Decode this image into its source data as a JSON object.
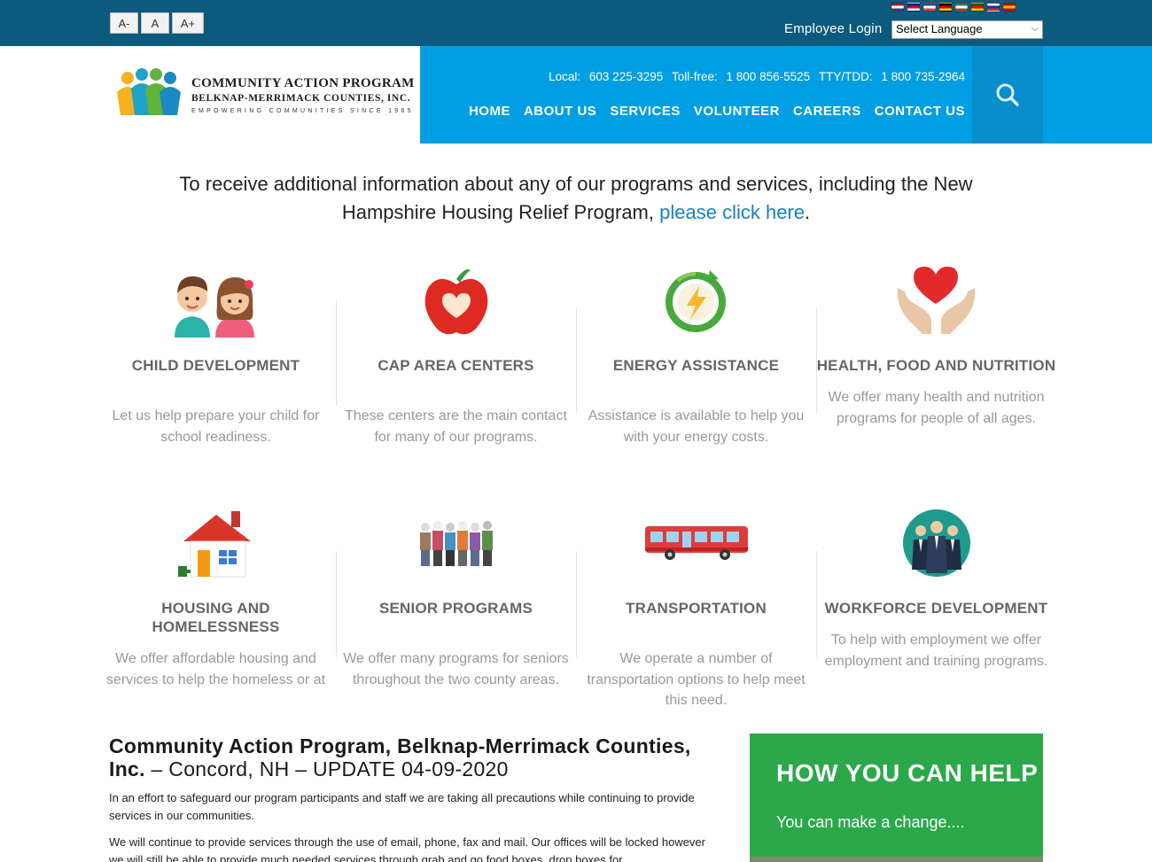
{
  "topbar": {
    "font_sizes": [
      "A-",
      "A",
      "A+"
    ],
    "employee_login": "Employee Login",
    "language_select": "Select Language",
    "flags": [
      {
        "name": "dutch-flag-icon",
        "colors": [
          "#ae1c28",
          "#ffffff",
          "#21468b"
        ]
      },
      {
        "name": "uk-flag-icon",
        "colors": [
          "#012169",
          "#c8102e",
          "#ffffff"
        ]
      },
      {
        "name": "french-flag-icon",
        "colors": [
          "#0055a4",
          "#ffffff",
          "#ef4135"
        ]
      },
      {
        "name": "german-flag-icon",
        "colors": [
          "#000000",
          "#dd0000",
          "#ffce00"
        ]
      },
      {
        "name": "italian-flag-icon",
        "colors": [
          "#009246",
          "#ffffff",
          "#ce2b37"
        ]
      },
      {
        "name": "portuguese-flag-icon",
        "colors": [
          "#006600",
          "#ff0000",
          "#ffcc00"
        ]
      },
      {
        "name": "russian-flag-icon",
        "colors": [
          "#ffffff",
          "#0039a6",
          "#d52b1e"
        ]
      },
      {
        "name": "spanish-flag-icon",
        "colors": [
          "#aa151b",
          "#f1bf00",
          "#aa151b"
        ]
      }
    ]
  },
  "logo": {
    "title": "COMMUNITY ACTION PROGRAM",
    "subtitle": "BELKNAP-MERRIMACK COUNTIES, INC.",
    "tagline": "EMPOWERING COMMUNITIES SINCE 1965"
  },
  "contact": {
    "local_label": "Local:",
    "local": "603 225-3295",
    "tollfree_label": "Toll-free:",
    "tollfree": "1 800 856-5525",
    "tty_label": "TTY/TDD:",
    "tty": "1 800 735-2964"
  },
  "nav": {
    "home": "HOME",
    "about": "ABOUT US",
    "services": "SERVICES",
    "volunteer": "VOLUNTEER",
    "careers": "CAREERS",
    "contact": "CONTACT US"
  },
  "intro": {
    "text": "To receive additional information about any of our programs and services, including the New Hampshire Housing Relief Program,",
    "link": "please click here",
    "end": "."
  },
  "services": [
    {
      "title": "CHILD DEVELOPMENT",
      "text": "Let us help prepare your child for school readiness.",
      "icon": "children-icon"
    },
    {
      "title": "CAP AREA CENTERS",
      "text": "These centers are the main contact for many of our programs.",
      "icon": "apple-icon"
    },
    {
      "title": "ENERGY ASSISTANCE",
      "text": "Assistance is available to help you with your energy costs.",
      "icon": "energy-icon"
    },
    {
      "title": "HEALTH, FOOD AND NUTRITION",
      "text": "We offer many health and nutrition programs for people of all ages.",
      "icon": "heart-hands-icon"
    },
    {
      "title": "HOUSING AND HOMELESSNESS",
      "text": "We offer affordable housing and services to help the homeless or at",
      "icon": "house-icon"
    },
    {
      "title": "SENIOR PROGRAMS",
      "text": "We offer many programs for seniors throughout the two county areas.",
      "icon": "seniors-icon"
    },
    {
      "title": "TRANSPORTATION",
      "text": "We operate a number of transportation options to help meet this need.",
      "icon": "bus-icon"
    },
    {
      "title": "WORKFORCE DEVELOPMENT",
      "text": "To help with employment we offer employment and training programs.",
      "icon": "workforce-icon"
    }
  ],
  "news": {
    "title_bold": "Community Action Program, Belknap-Merrimack Counties, Inc.",
    "title_rest": " – Concord, NH – UPDATE 04-09-2020",
    "p1": "In an effort to safeguard our program participants and staff we are taking all precautions while continuing to provide services in our communities.",
    "p2": "We will continue to provide services through the use of email, phone, fax and mail.  Our offices will be locked however we will still be able to provide much needed services through grab and go food boxes, drop boxes for"
  },
  "help": {
    "title": "HOW YOU CAN HELP",
    "subtitle": "You can make a change...."
  },
  "colors": {
    "topbar": "#0c5a7d",
    "header_blue": "#009ee3",
    "search_blue": "#0a8ecb",
    "link": "#1a7fc1",
    "help_green": "#2ba84a"
  }
}
